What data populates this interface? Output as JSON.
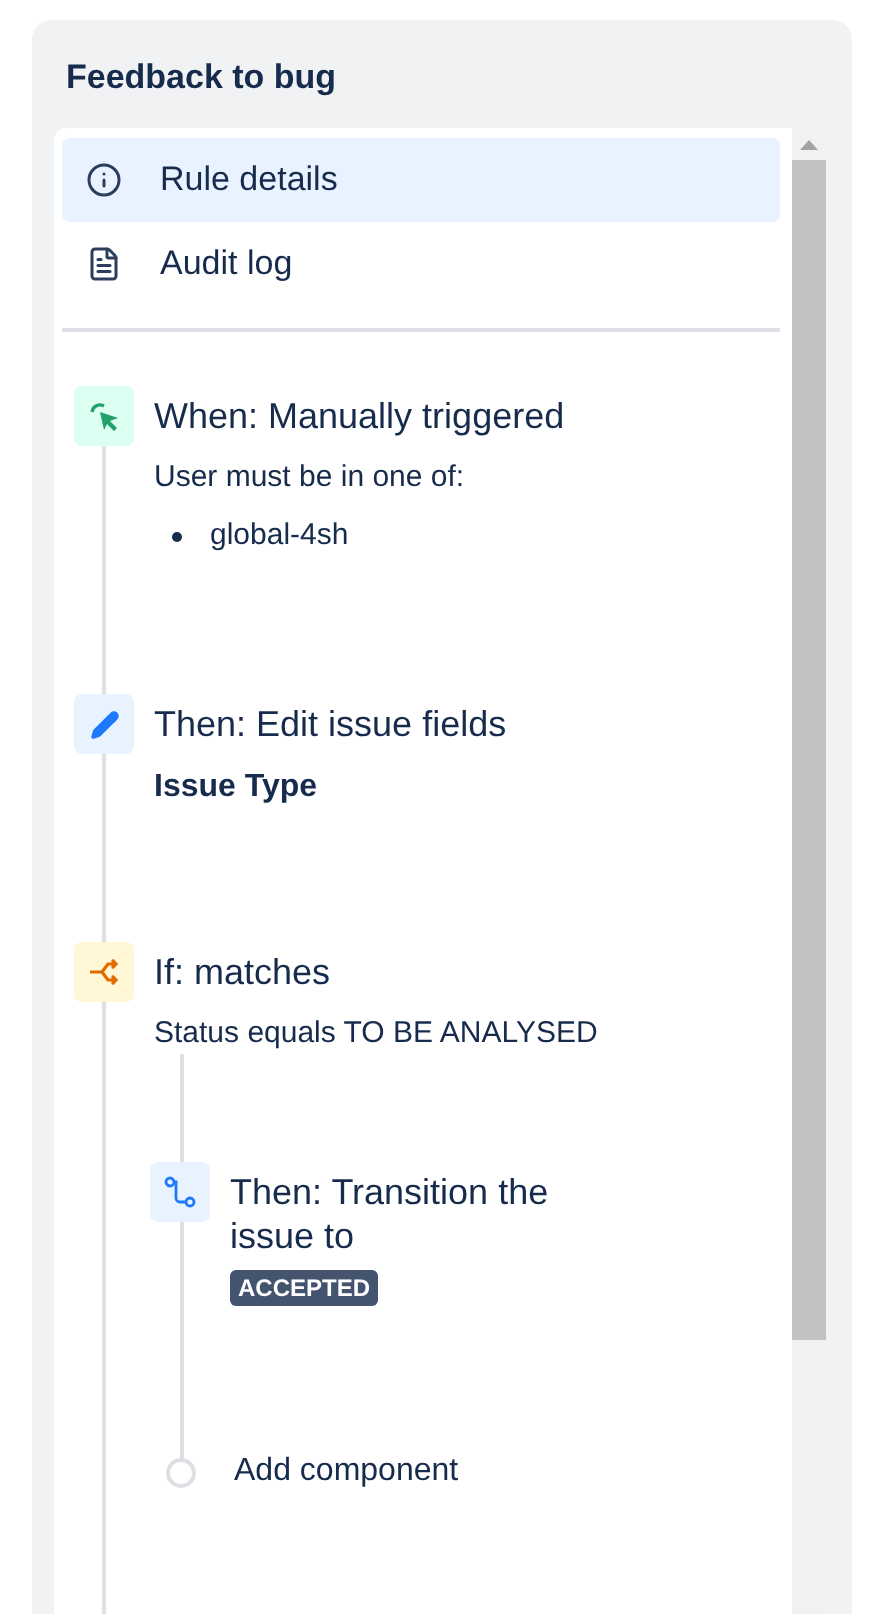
{
  "panel": {
    "title": "Feedback to bug"
  },
  "nav": [
    {
      "label": "Rule details",
      "kind": "info",
      "selected": true
    },
    {
      "label": "Audit log",
      "kind": "log",
      "selected": false
    }
  ],
  "steps": [
    {
      "kind": "trigger",
      "title": "When: Manually triggered",
      "description": "User must be in one of:",
      "bullets": [
        "global-4sh"
      ]
    },
    {
      "kind": "action",
      "title": "Then: Edit issue fields",
      "field": "Issue Type"
    },
    {
      "kind": "condition",
      "title": "If: matches",
      "description": "Status equals TO BE ANALYSED",
      "children": [
        {
          "kind": "transition",
          "title": "Then: Transition the issue to",
          "status": "ACCEPTED"
        },
        {
          "kind": "add",
          "title": "Add component"
        }
      ]
    }
  ]
}
